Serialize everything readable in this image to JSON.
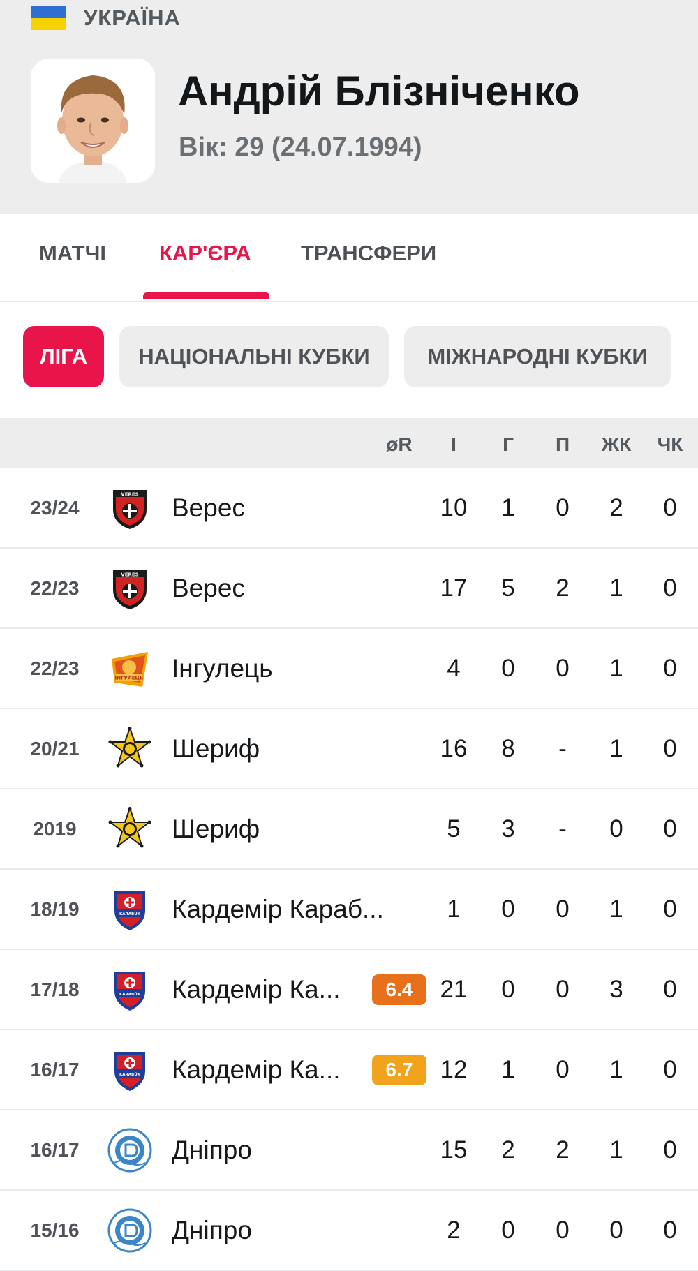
{
  "header": {
    "country": "УКРАЇНА",
    "player_name": "Андрій Блізніченко",
    "player_age": "Вік: 29 (24.07.1994)"
  },
  "tabs": [
    {
      "label": "МАТЧІ",
      "active": false
    },
    {
      "label": "КАР'ЄРА",
      "active": true
    },
    {
      "label": "ТРАНСФЕРИ",
      "active": false
    }
  ],
  "filters": [
    {
      "label": "ЛІГА",
      "active": true
    },
    {
      "label": "НАЦІОНАЛЬНІ КУБКИ",
      "active": false
    },
    {
      "label": "МІЖНАРОДНІ КУБКИ",
      "active": false
    }
  ],
  "table": {
    "headers": [
      "øR",
      "І",
      "Г",
      "П",
      "ЖК",
      "ЧК"
    ],
    "rows": [
      {
        "season": "23/24",
        "club": "Верес",
        "logo": "veres-logo",
        "rating": "",
        "apps": "10",
        "goals": "1",
        "assists": "0",
        "yellow": "2",
        "red": "0"
      },
      {
        "season": "22/23",
        "club": "Верес",
        "logo": "veres-logo",
        "rating": "",
        "apps": "17",
        "goals": "5",
        "assists": "2",
        "yellow": "1",
        "red": "0"
      },
      {
        "season": "22/23",
        "club": "Інгулець",
        "logo": "inhulets-logo",
        "rating": "",
        "apps": "4",
        "goals": "0",
        "assists": "0",
        "yellow": "1",
        "red": "0"
      },
      {
        "season": "20/21",
        "club": "Шериф",
        "logo": "sheriff-logo",
        "rating": "",
        "apps": "16",
        "goals": "8",
        "assists": "-",
        "yellow": "1",
        "red": "0"
      },
      {
        "season": "2019",
        "club": "Шериф",
        "logo": "sheriff-logo",
        "rating": "",
        "apps": "5",
        "goals": "3",
        "assists": "-",
        "yellow": "0",
        "red": "0"
      },
      {
        "season": "18/19",
        "club": "Кардемір Караб...",
        "logo": "kardemir-logo",
        "rating": "",
        "apps": "1",
        "goals": "0",
        "assists": "0",
        "yellow": "1",
        "red": "0"
      },
      {
        "season": "17/18",
        "club": "Кардемір Ка...",
        "logo": "kardemir-logo",
        "rating": "6.4",
        "rating_color": "#e8701a",
        "apps": "21",
        "goals": "0",
        "assists": "0",
        "yellow": "3",
        "red": "0"
      },
      {
        "season": "16/17",
        "club": "Кардемір Ка...",
        "logo": "kardemir-logo",
        "rating": "6.7",
        "rating_color": "#f2a31c",
        "apps": "12",
        "goals": "1",
        "assists": "0",
        "yellow": "1",
        "red": "0"
      },
      {
        "season": "16/17",
        "club": "Дніпро",
        "logo": "dnipro-logo",
        "rating": "",
        "apps": "15",
        "goals": "2",
        "assists": "2",
        "yellow": "1",
        "red": "0"
      },
      {
        "season": "15/16",
        "club": "Дніпро",
        "logo": "dnipro-logo",
        "rating": "",
        "apps": "2",
        "goals": "0",
        "assists": "0",
        "yellow": "0",
        "red": "0"
      }
    ]
  },
  "colors": {
    "accent": "#e8144a",
    "header_bg": "#ededee"
  }
}
